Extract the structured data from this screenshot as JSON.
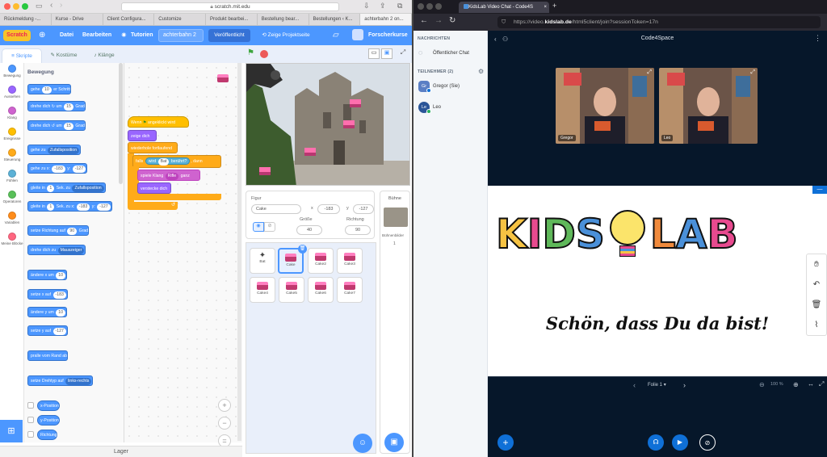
{
  "safari": {
    "url": "scratch.mit.edu",
    "tabs": [
      "Rückmeldung -...",
      "Kurse - Drive",
      "Client Configura...",
      "Customize",
      "Produkt bearbei...",
      "Bestellung bear...",
      "Bestellungen ‹ K...",
      "achterbahn 2 on..."
    ]
  },
  "scratch_menu": {
    "logo": "Scratch",
    "file": "Datei",
    "edit": "Bearbeiten",
    "tutorials": "Tutorien",
    "project_title": "achterbahn 2",
    "share": "Veröffentlicht",
    "see_page": "Zeige Projektseite",
    "user": "Forscherkurse"
  },
  "scratch_tabs": {
    "scripts": "Skripte",
    "costumes": "Kostüme",
    "sounds": "Klänge"
  },
  "categories": [
    {
      "label": "Bewegung",
      "color": "#4c97ff"
    },
    {
      "label": "Aussehen",
      "color": "#9966ff"
    },
    {
      "label": "Klang",
      "color": "#cf63cf"
    },
    {
      "label": "Ereignisse",
      "color": "#ffbf00"
    },
    {
      "label": "Steuerung",
      "color": "#ffab19"
    },
    {
      "label": "Fühlen",
      "color": "#5cb1d6"
    },
    {
      "label": "Operatoren",
      "color": "#59c059"
    },
    {
      "label": "Variablen",
      "color": "#ff8c1a"
    },
    {
      "label": "Meine Blöcke",
      "color": "#ff6680"
    }
  ],
  "palette": {
    "heading": "Bewegung",
    "move": {
      "a": "gehe",
      "v": "10",
      "b": "er Schritt"
    },
    "turn_right": {
      "a": "drehe dich",
      "v": "15",
      "b": "Grad",
      "icon": "↻ um"
    },
    "turn_left": {
      "a": "drehe dich",
      "v": "15",
      "b": "Grad",
      "icon": "↺ um"
    },
    "goto": {
      "a": "gehe zu",
      "d": "Zufallsposition"
    },
    "goto_xy": {
      "a": "gehe zu x:",
      "x": "-183",
      "b": "y:",
      "y": "-127"
    },
    "glide": {
      "a": "gleite in",
      "v": "1",
      "b": "Sek. zu",
      "d": "Zufallsposition"
    },
    "glide_xy": {
      "a": "gleite in",
      "v": "1",
      "b": "Sek. zu x:",
      "x": "-183",
      "c": "y:",
      "y": "-127"
    },
    "direction": {
      "a": "setze Richtung auf",
      "v": "90",
      "b": "Grad"
    },
    "point_to": {
      "a": "drehe dich zu",
      "d": "Mauszeiger"
    },
    "change_x": {
      "a": "ändere x um",
      "v": "10"
    },
    "set_x": {
      "a": "setze x auf",
      "v": "-183"
    },
    "change_y": {
      "a": "ändere y um",
      "v": "10"
    },
    "set_y": {
      "a": "setze y auf",
      "v": "-127"
    },
    "bounce": "pralle vom Rand ab",
    "rotation": {
      "a": "setze Drehtyp auf",
      "d": "links-rechts"
    },
    "rep_x": "x-Position",
    "rep_y": "y-Position",
    "rep_dir": "Richtung"
  },
  "script": {
    "hat": "Wenn",
    "hat2": "angeklickt wird",
    "show": "zeige dich",
    "forever": "wiederhole fortlaufend",
    "if": "falls",
    "touching": "wird",
    "touch_target": "Bat",
    "touched": "berührt?",
    "then": ", dann",
    "sound": "spiele Klang",
    "sound_name": "Rifle",
    "sound_end": "ganz",
    "hide": "verstecke dich"
  },
  "lager": "Lager",
  "sprite_info": {
    "label": "Figur",
    "name": "Cake",
    "x_label": "x",
    "x": "-183",
    "y_label": "y",
    "y": "-127",
    "size_label": "Größe",
    "size": "40",
    "dir_label": "Richtung",
    "dir": "90"
  },
  "stage_panel": {
    "label": "Bühne",
    "bg_label": "Bühnenbilder",
    "bg_count": "1"
  },
  "sprites": [
    "Bat",
    "Cake",
    "Cake2",
    "Cake3",
    "Cake4",
    "Cake5",
    "Cake6",
    "Cake7"
  ],
  "firefox": {
    "tab_title": "KidsLab Video Chat - Code4S",
    "url_prefix": "https://video.",
    "url_domain": "kidslab.de",
    "url_suffix": "/html5client/join?sessionToken=17n"
  },
  "bbb": {
    "messages_head": "NACHRICHTEN",
    "public_chat": "Öffentlicher Chat",
    "users_head": "TEILNEHMER (2)",
    "users": [
      {
        "initials": "Gr",
        "name": "Gregor (Sie)",
        "color": "#5a7ec4"
      },
      {
        "initials": "Le",
        "name": "Leo",
        "color": "#2a5598"
      }
    ],
    "room_title": "Code4Space",
    "videos": [
      {
        "name": "Gregor"
      },
      {
        "name": "Leo"
      }
    ],
    "whiteboard": {
      "logo_letters": [
        "K",
        "I",
        "D",
        "S",
        "L",
        "A",
        "B"
      ],
      "logo_colors": [
        "#f6c343",
        "#e84a8f",
        "#5fb85a",
        "#4a90d9",
        "#f08a3c",
        "#4a90d9",
        "#e84a8f"
      ],
      "welcome": "Schön, dass Du da bist!",
      "slide": "Folie 1",
      "zoom": "100 %"
    }
  }
}
